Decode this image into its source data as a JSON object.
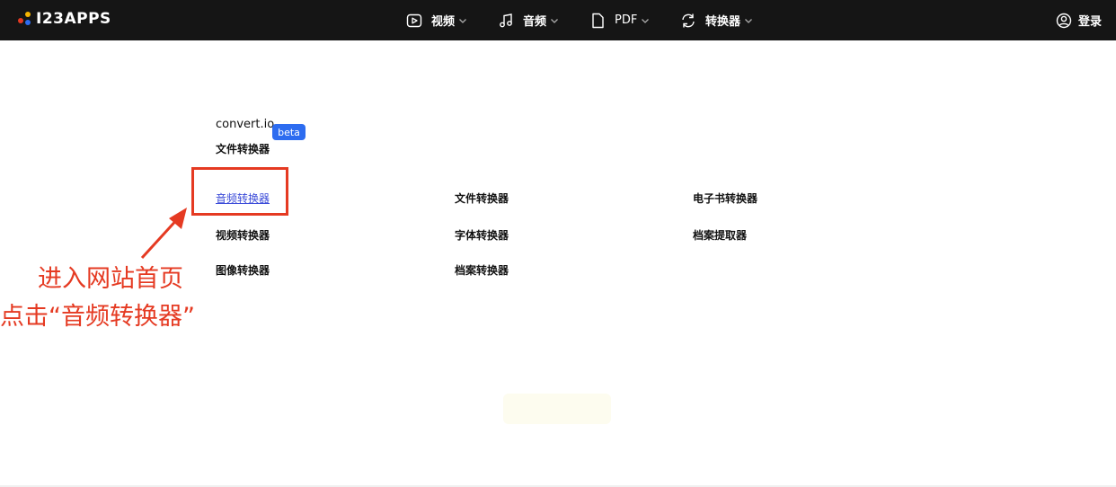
{
  "header": {
    "logo_text": "I23APPS",
    "nav": [
      {
        "label": "视频",
        "icon": "video-icon"
      },
      {
        "label": "音频",
        "icon": "music-note-icon"
      },
      {
        "label": "PDF",
        "icon": "document-icon"
      },
      {
        "label": "转换器",
        "icon": "convert-icon"
      }
    ],
    "login_label": "登录"
  },
  "main": {
    "brand": "convert.io",
    "beta_badge": "beta",
    "subtitle": "文件转换器",
    "columns": [
      [
        "音频转换器",
        "视频转换器",
        "图像转换器"
      ],
      [
        "文件转换器",
        "字体转换器",
        "档案转换器"
      ],
      [
        "电子书转换器",
        "档案提取器"
      ]
    ]
  },
  "annotation": {
    "line1": "进入网站首页",
    "line2": "点击“音频转换器”"
  },
  "colors": {
    "topbar": "#151515",
    "beta": "#2d6cf0",
    "link_active": "#3b4bd8",
    "annotation_red": "#e53a22",
    "logo_dots": [
      "#2d6cf0",
      "#f5b400",
      "#e53a22"
    ]
  }
}
